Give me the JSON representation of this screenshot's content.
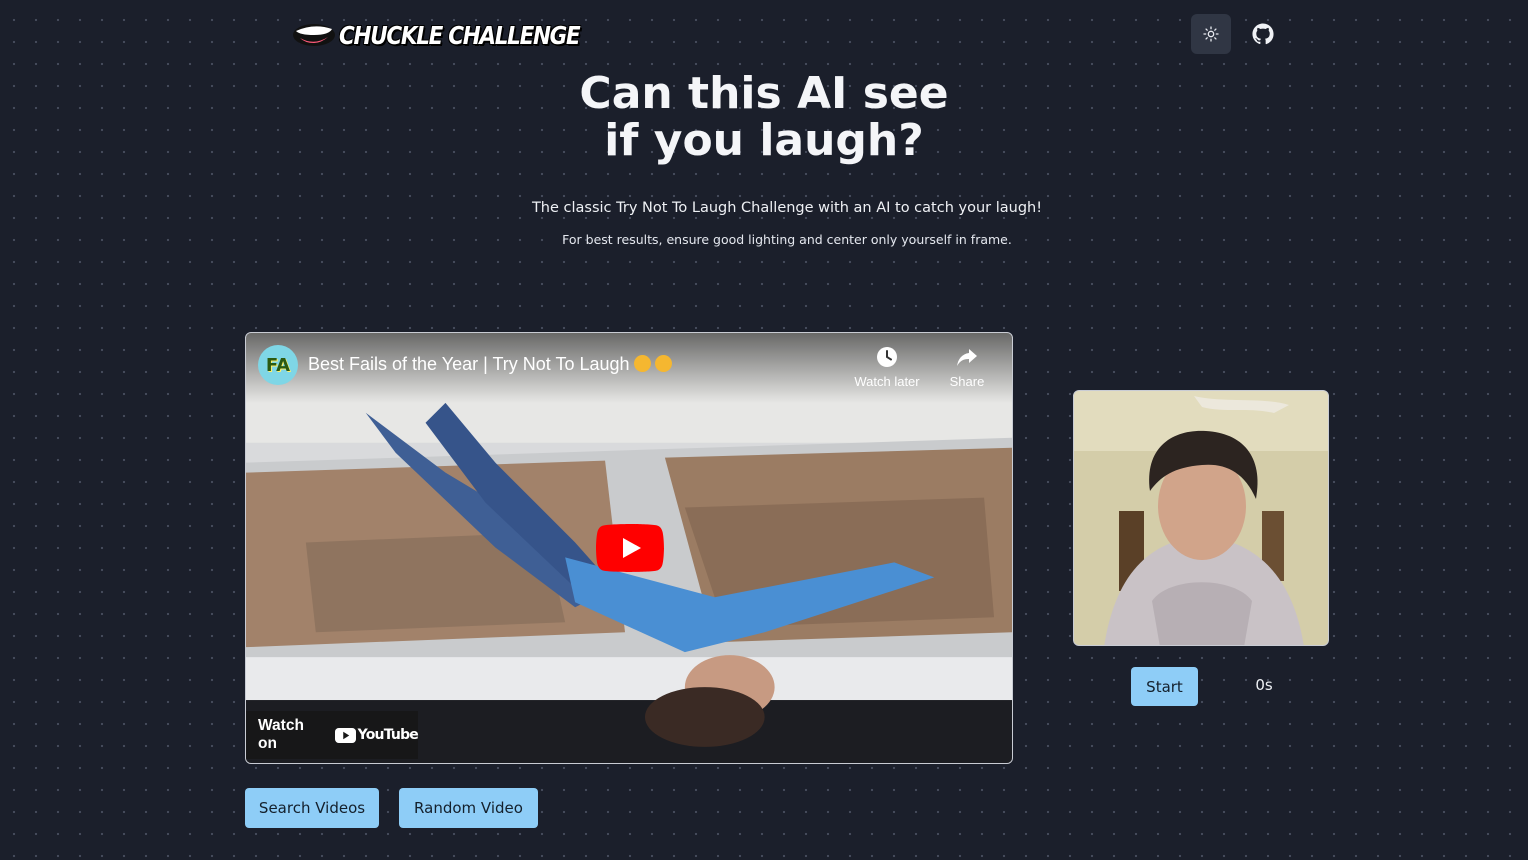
{
  "header": {
    "logo_text": "CHUCKLE CHALLENGE",
    "theme_toggle_icon": "sun-icon",
    "github_icon": "github-icon"
  },
  "hero": {
    "title_line1": "Can this AI see",
    "title_line2": "if you laugh?",
    "subtitle": "The classic Try Not To Laugh Challenge with an AI to catch your laugh!",
    "note": "For best results, ensure good lighting and center only yourself in frame."
  },
  "video": {
    "channel_avatar": "FA",
    "title": "Best Fails of the Year | Try Not To Laugh",
    "watch_later_label": "Watch later",
    "share_label": "Share",
    "watch_on_label": "Watch on",
    "youtube_label": "YouTube"
  },
  "controls": {
    "start_label": "Start",
    "timer": "0s",
    "search_label": "Search Videos",
    "random_label": "Random Video"
  },
  "colors": {
    "background": "#1b1f2b",
    "button": "#8ecdf7",
    "youtube_red": "#ff0000"
  }
}
